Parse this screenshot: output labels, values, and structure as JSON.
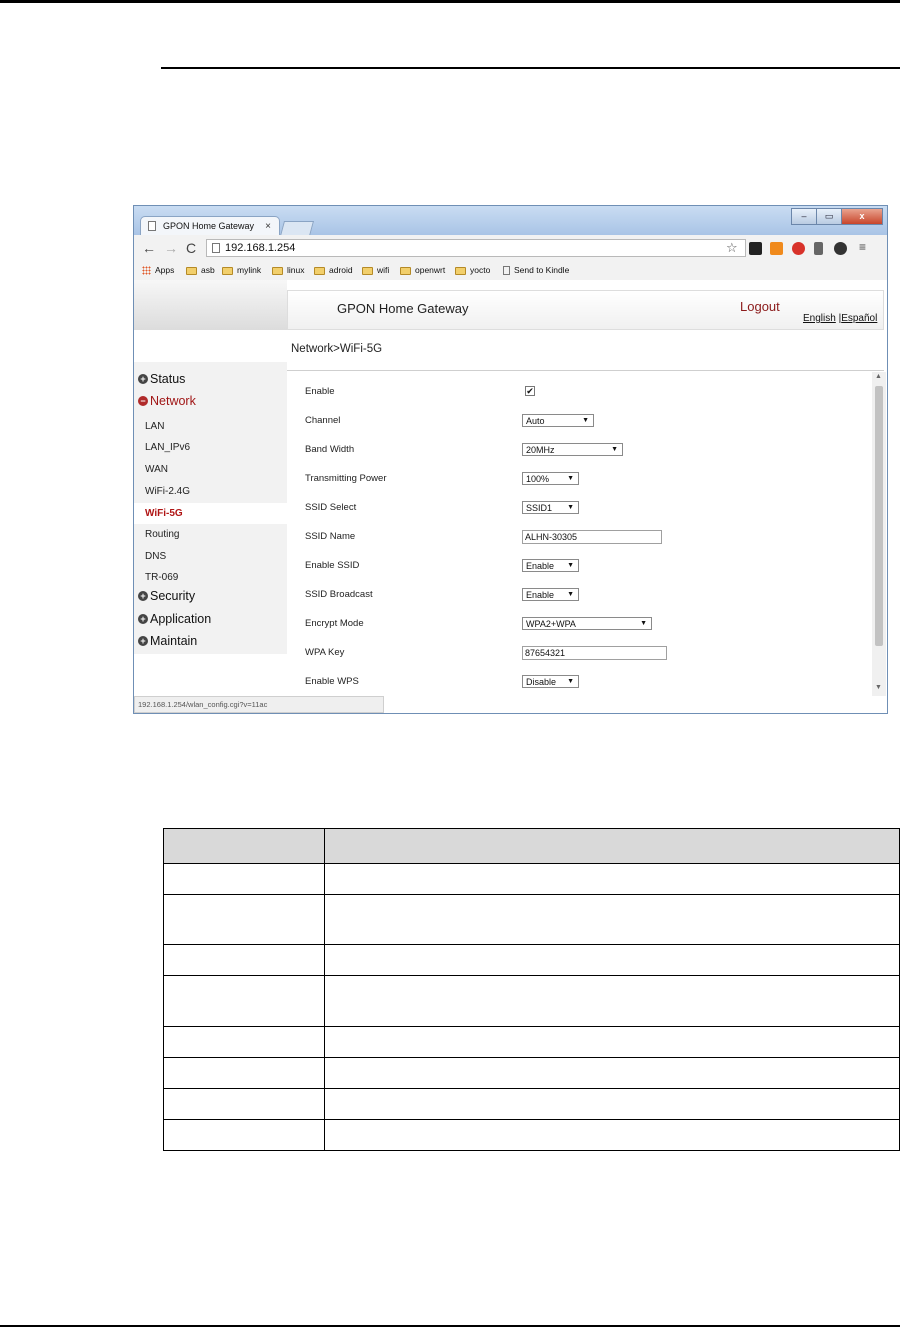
{
  "browser": {
    "tab_title": "GPON Home Gateway",
    "tab_close": "×",
    "url": "192.168.1.254",
    "window_buttons": [
      "–",
      "▭",
      "x"
    ],
    "bookmarks": [
      "Apps",
      "asb",
      "mylink",
      "linux",
      "adroid",
      "wifi",
      "openwrt",
      "yocto",
      "Send to Kindle"
    ],
    "status_url": "192.168.1.254/wlan_config.cgi?v=11ac"
  },
  "gateway": {
    "title": "GPON Home Gateway",
    "logout": "Logout",
    "lang_english": "English",
    "lang_sep": "|",
    "lang_spanish": "Español",
    "breadcrumb": "Network>WiFi-5G"
  },
  "sidebar": {
    "status": "Status",
    "network": "Network",
    "subitems": [
      "LAN",
      "LAN_IPv6",
      "WAN",
      "WiFi-2.4G",
      "WiFi-5G",
      "Routing",
      "DNS",
      "TR-069"
    ],
    "security": "Security",
    "application": "Application",
    "maintain": "Maintain"
  },
  "form": {
    "enable_label": "Enable",
    "enable_checked": true,
    "channel_label": "Channel",
    "channel_value": "Auto",
    "bandwidth_label": "Band Width",
    "bandwidth_value": "20MHz",
    "txpower_label": "Transmitting Power",
    "txpower_value": "100%",
    "ssid_select_label": "SSID Select",
    "ssid_select_value": "SSID1",
    "ssid_name_label": "SSID Name",
    "ssid_name_value": "ALHN-30305",
    "enable_ssid_label": "Enable SSID",
    "enable_ssid_value": "Enable",
    "ssid_broadcast_label": "SSID Broadcast",
    "ssid_broadcast_value": "Enable",
    "encrypt_label": "Encrypt Mode",
    "encrypt_value": "WPA2+WPA",
    "wpa_key_label": "WPA Key",
    "wpa_key_value": "87654321",
    "wps_label": "Enable WPS",
    "wps_value": "Disable"
  },
  "colors": {
    "accent_red": "#a01616",
    "table_header": "#d9d9d9"
  }
}
